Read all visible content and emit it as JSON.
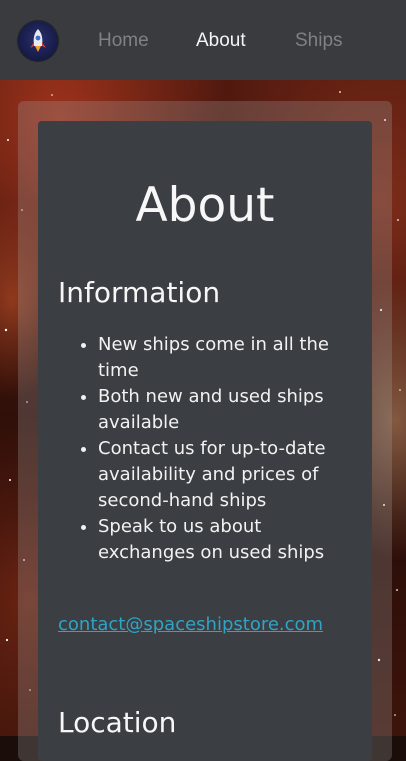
{
  "nav": {
    "logo_icon": "rocket-logo-icon",
    "links": [
      {
        "label": "Home",
        "active": false
      },
      {
        "label": "About",
        "active": true
      },
      {
        "label": "Ships",
        "active": false
      }
    ]
  },
  "main": {
    "title": "About",
    "information": {
      "heading": "Information",
      "items": [
        "New ships come in all the time",
        "Both new and used ships available",
        "Contact us for up-to-date availability and prices of second-hand ships",
        "Speak to us about exchanges on used ships"
      ],
      "email": "contact@spaceshipstore.com"
    },
    "location": {
      "heading": "Location"
    }
  },
  "colors": {
    "navbar": "#3a3b3e",
    "card": "#3b3e42",
    "link": "#2fa4c8",
    "nav_inactive": "#7f8185",
    "nav_active": "#f4f4f4"
  }
}
